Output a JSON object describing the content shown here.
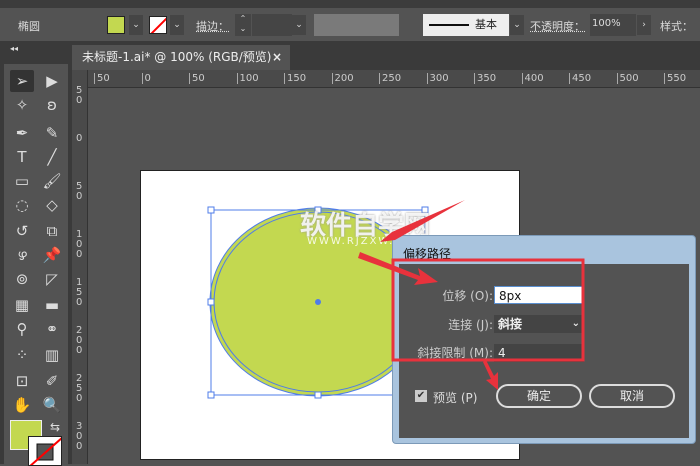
{
  "control_bar": {
    "object_type": "椭圆",
    "fill_color": "#c3d850",
    "stroke_label": "描边：",
    "brush_label": "基本",
    "opacity_label": "不透明度：",
    "opacity_value": "100%",
    "style_label": "样式："
  },
  "document_tab": {
    "title": "未标题-1.ai* @ 100% (RGB/预览)",
    "close": "×"
  },
  "ruler_h": [
    "50",
    "0",
    "50",
    "100",
    "150",
    "200",
    "250",
    "300",
    "350",
    "400",
    "450",
    "500",
    "550"
  ],
  "ruler_v": [
    "5 0",
    "0",
    "5 0",
    "1 0 0",
    "1 5 0",
    "2 0 0",
    "2 5 0",
    "3 0 0"
  ],
  "watermark": {
    "text": "软件自学网",
    "url": "WWW.RJZXW.COM"
  },
  "dialog": {
    "title": "偏移路径",
    "offset_label": "位移 (O):",
    "offset_value": "8px",
    "join_label": "连接 (J):",
    "join_value": "斜接",
    "miter_label": "斜接限制 (M):",
    "miter_value": "4",
    "preview_label": "预览 (P)",
    "preview_checked": true,
    "ok_label": "确定",
    "cancel_label": "取消"
  },
  "colors": {
    "accent_fill": "#c3d850",
    "selection": "#4f7ce8",
    "annotation": "#e8323c"
  }
}
